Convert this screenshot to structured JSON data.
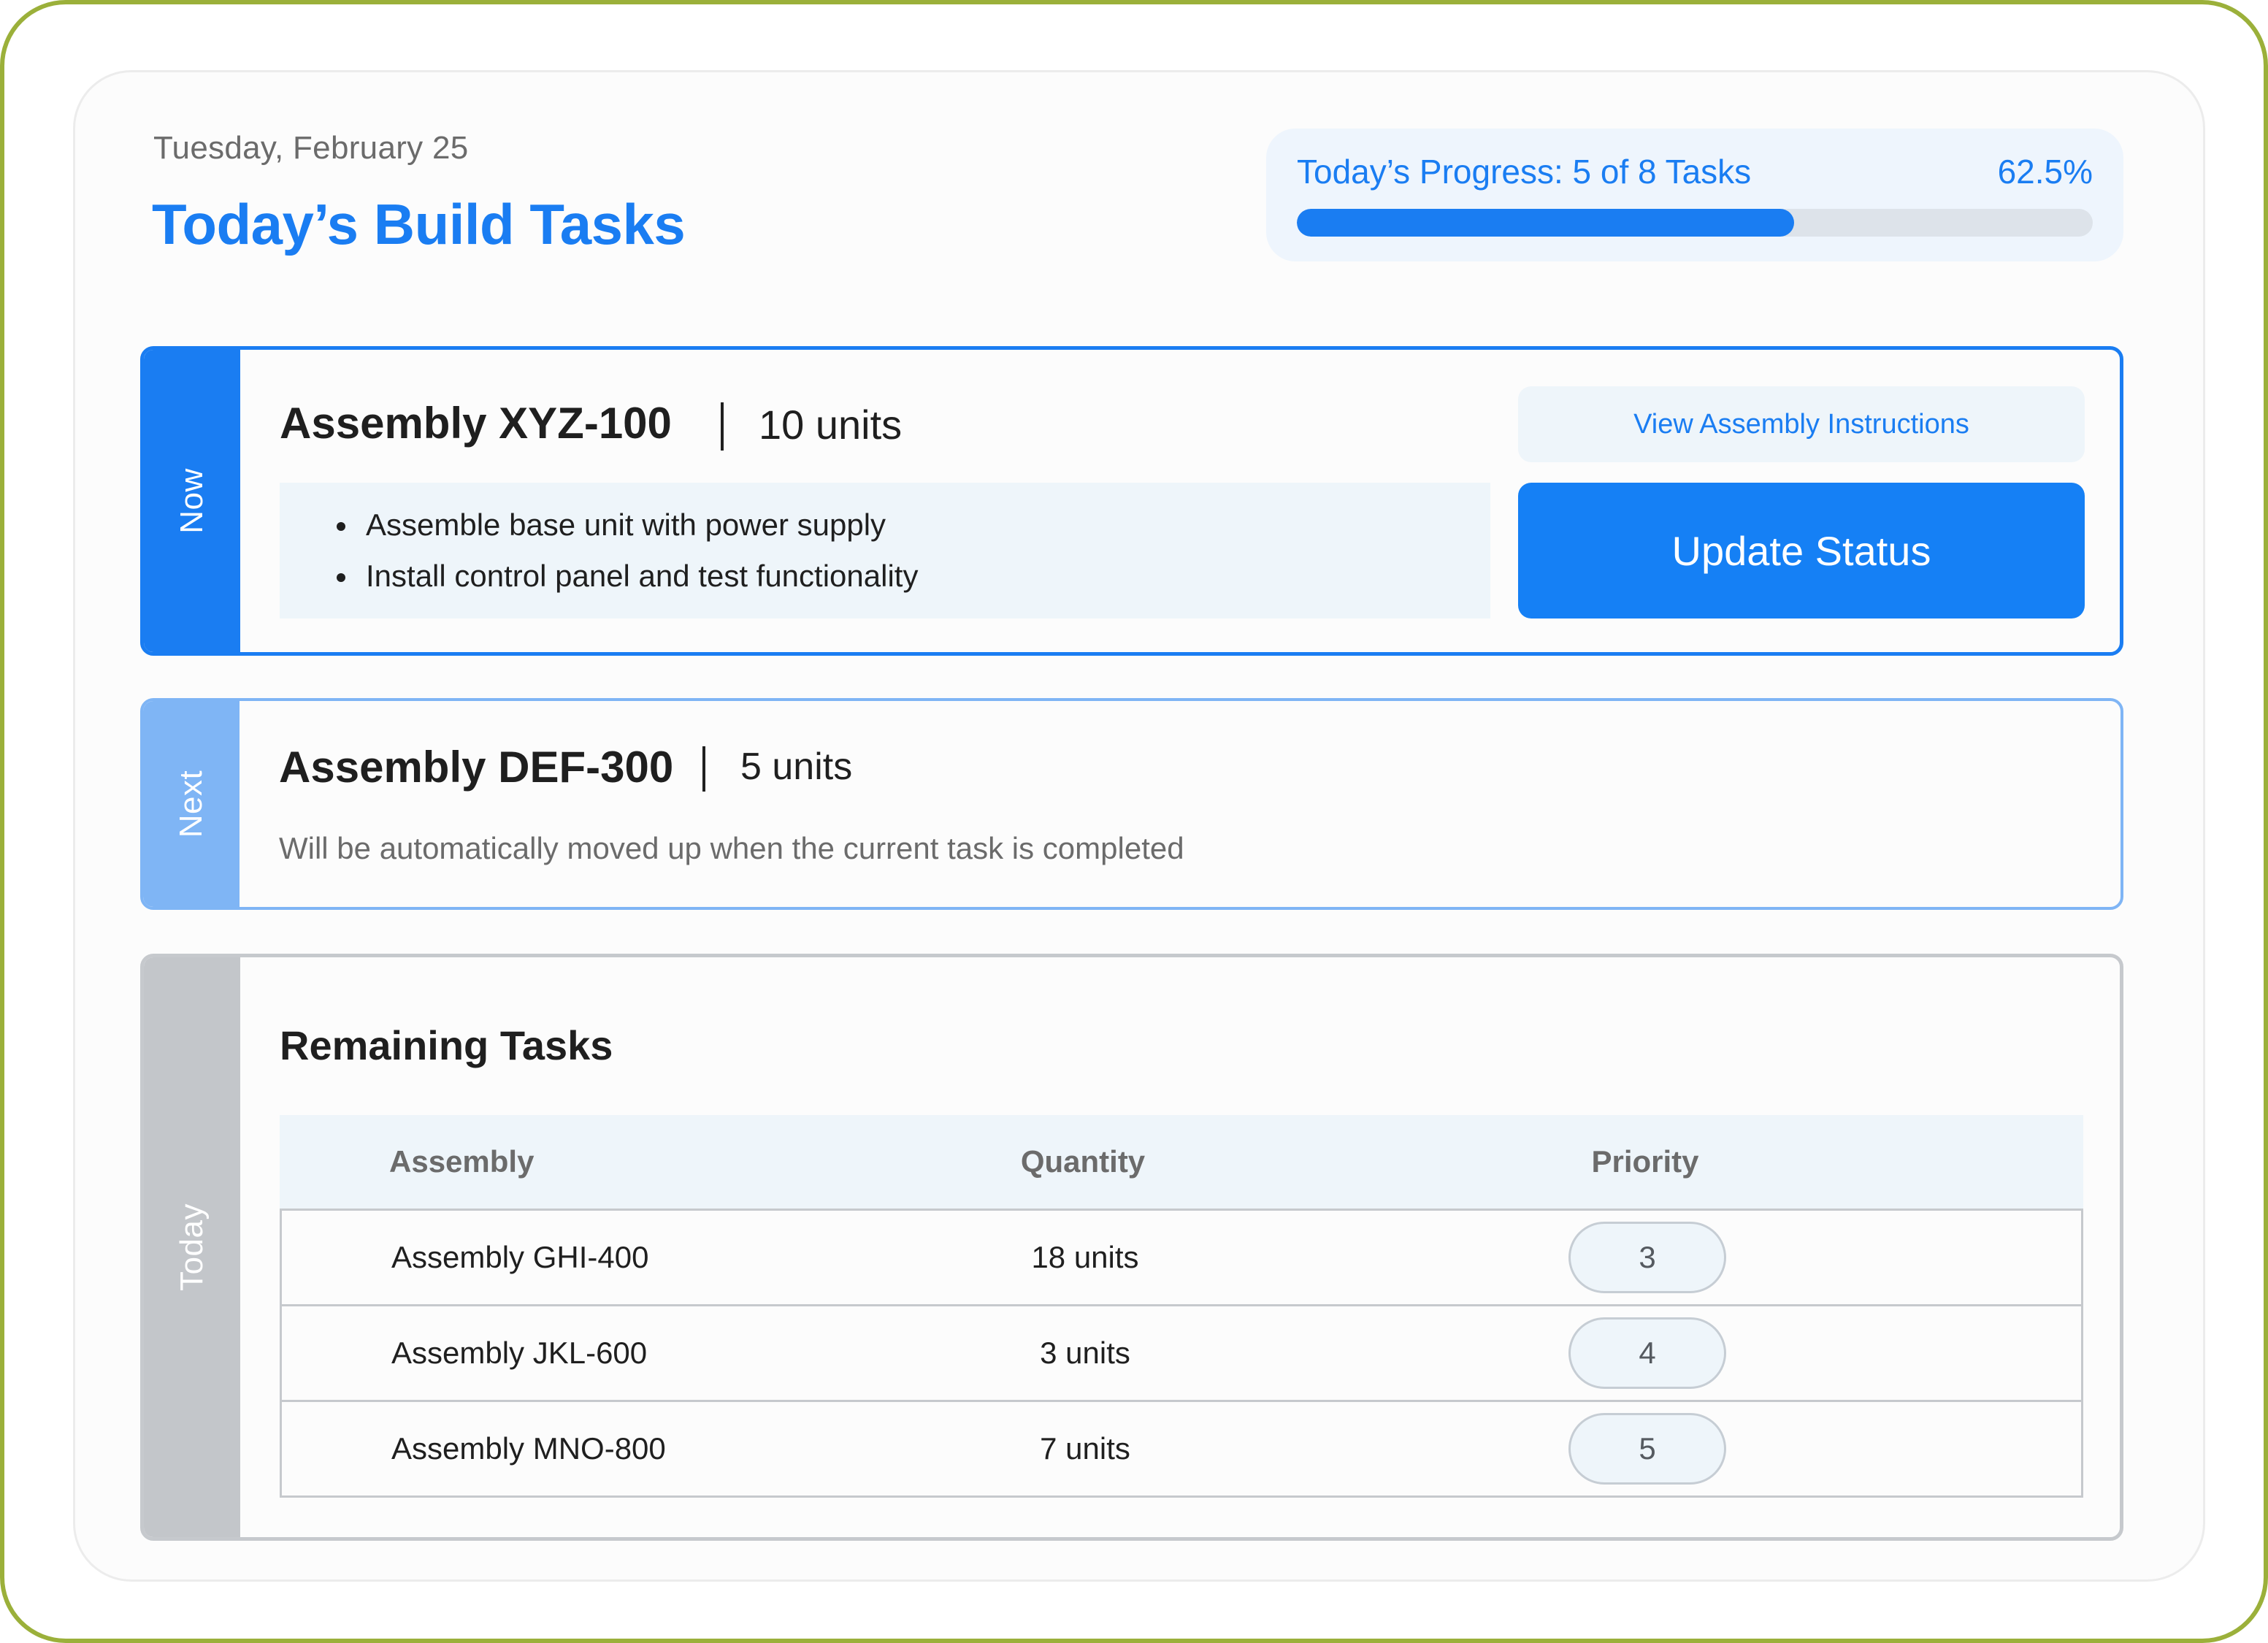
{
  "header": {
    "date": "Tuesday, February 25",
    "title": "Today’s Build Tasks"
  },
  "progress": {
    "label": "Today’s Progress: 5 of 8 Tasks",
    "percent_label": "62.5%",
    "completed": 5,
    "total": 8,
    "fraction": 0.625
  },
  "now": {
    "tab_label": "Now",
    "assembly": "Assembly XYZ-100",
    "units": "10 units",
    "steps": [
      "Assemble base unit with power supply",
      "Install control panel and test functionality"
    ],
    "view_button": "View Assembly Instructions",
    "update_button": "Update Status"
  },
  "next": {
    "tab_label": "Next",
    "assembly": "Assembly DEF-300",
    "units": "5 units",
    "note": "Will be automatically moved up when the current task is completed"
  },
  "today": {
    "tab_label": "Today",
    "title": "Remaining Tasks",
    "columns": [
      "Assembly",
      "Quantity",
      "Priority"
    ],
    "rows": [
      {
        "assembly": "Assembly GHI-400",
        "quantity": "18 units",
        "priority": "3"
      },
      {
        "assembly": "Assembly JKL-600",
        "quantity": "3 units",
        "priority": "4"
      },
      {
        "assembly": "Assembly MNO-800",
        "quantity": "7 units",
        "priority": "5"
      }
    ]
  },
  "colors": {
    "accent": "#1a7df2",
    "next_accent": "#7fb5f5",
    "today_accent": "#c3c6ca",
    "frame": "#9bb03a"
  }
}
